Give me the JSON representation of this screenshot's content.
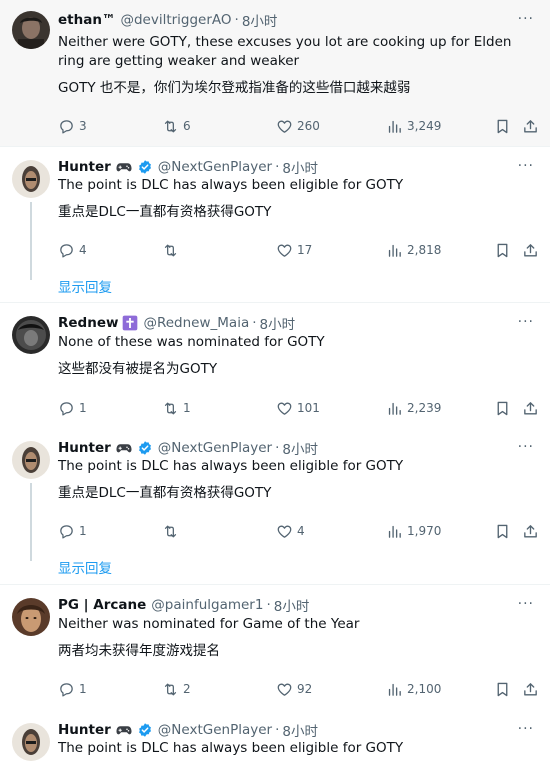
{
  "colors": {
    "accent": "#1d9bf0",
    "muted": "#536471",
    "text": "#0f1419",
    "highlight_bg": "#f7f7f7",
    "purple_badge": "#8e6bd8"
  },
  "icons": {
    "reply": "reply-icon",
    "retweet": "retweet-icon",
    "like": "heart-icon",
    "views": "views-icon",
    "bookmark": "bookmark-icon",
    "share": "share-icon",
    "more": "more-icon",
    "verified": "verified-badge-icon",
    "gamepad": "gamepad-icon",
    "cross": "cross-icon"
  },
  "tweets": [
    {
      "name": "ethan™",
      "handle": "@deviltriggerAO",
      "time": "8小时",
      "text": "Neither were GOTY, these excuses you lot are cooking up for Elden ring are getting weaker and weaker",
      "translation": "GOTY 也不是，你们为埃尔登戒指准备的这些借口越来越弱",
      "replies": "3",
      "retweets": "6",
      "likes": "260",
      "views": "3,249"
    },
    {
      "name": "Hunter",
      "handle": "@NextGenPlayer",
      "time": "8小时",
      "text": "The point is DLC has always been eligible for GOTY",
      "translation": "重点是DLC一直都有资格获得GOTY",
      "replies": "4",
      "retweets": "",
      "likes": "17",
      "views": "2,818",
      "show_replies": "显示回复"
    },
    {
      "name": "Rednew",
      "handle": "@Rednew_Maia",
      "time": "8小时",
      "text": "None of these was nominated for GOTY",
      "translation": "这些都没有被提名为GOTY",
      "replies": "1",
      "retweets": "1",
      "likes": "101",
      "views": "2,239"
    },
    {
      "name": "Hunter",
      "handle": "@NextGenPlayer",
      "time": "8小时",
      "text": "The point is DLC has always been eligible for GOTY",
      "translation": "重点是DLC一直都有资格获得GOTY",
      "replies": "1",
      "retweets": "",
      "likes": "4",
      "views": "1,970",
      "show_replies": "显示回复"
    },
    {
      "name": "PG | Arcane",
      "handle": "@painfulgamer1",
      "time": "8小时",
      "text": "Neither was nominated for Game of the Year",
      "translation": "两者均未获得年度游戏提名",
      "replies": "1",
      "retweets": "2",
      "likes": "92",
      "views": "2,100"
    },
    {
      "name": "Hunter",
      "handle": "@NextGenPlayer",
      "time": "8小时",
      "text": "The point is DLC has always been eligible for GOTY"
    }
  ]
}
